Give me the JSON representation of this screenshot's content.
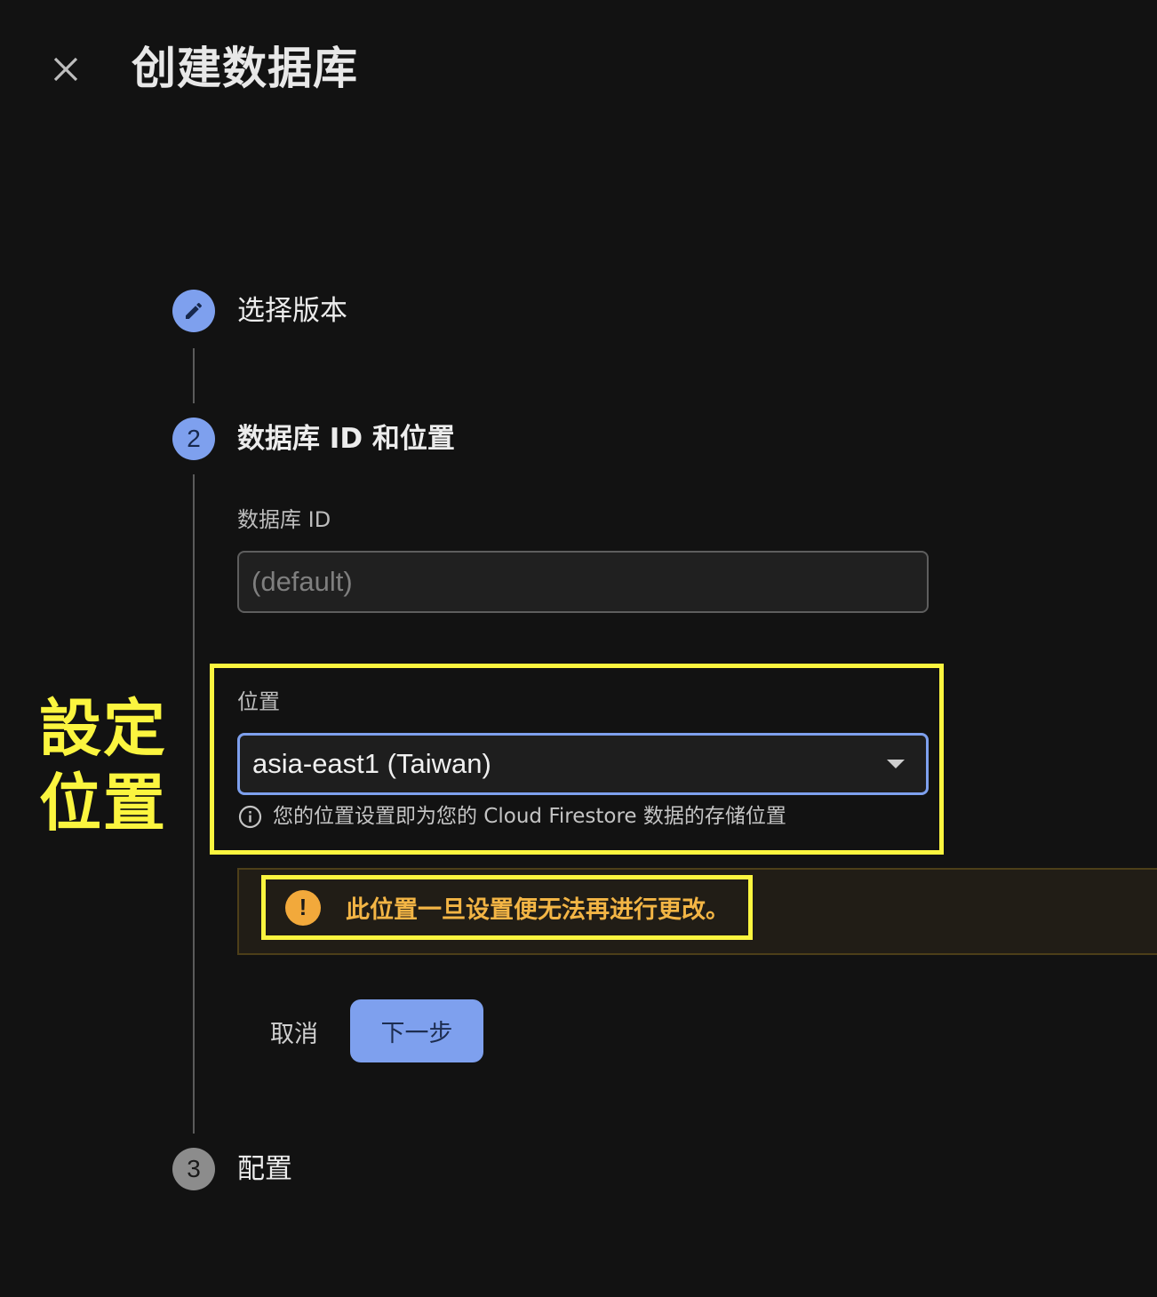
{
  "header": {
    "close_icon": "close-icon",
    "title": "创建数据库"
  },
  "steps": [
    {
      "number": "",
      "label": "选择版本",
      "state": "done",
      "icon": "pencil-icon"
    },
    {
      "number": "2",
      "label": "数据库 ID 和位置",
      "state": "active"
    },
    {
      "number": "3",
      "label": "配置",
      "state": "pending"
    }
  ],
  "form": {
    "db_id_label": "数据库 ID",
    "db_id_placeholder": "(default)",
    "location_label": "位置",
    "location_value": "asia-east1 (Taiwan)",
    "location_hint": "您的位置设置即为您的 Cloud Firestore 数据的存储位置",
    "warning": "此位置一旦设置便无法再进行更改。"
  },
  "actions": {
    "cancel": "取消",
    "next": "下一步"
  },
  "annotation": {
    "line1": "設定",
    "line2": "位置"
  },
  "colors": {
    "accent": "#7ea0ee",
    "highlight": "#fbf53f",
    "warning": "#f3b545",
    "background": "#121212"
  }
}
